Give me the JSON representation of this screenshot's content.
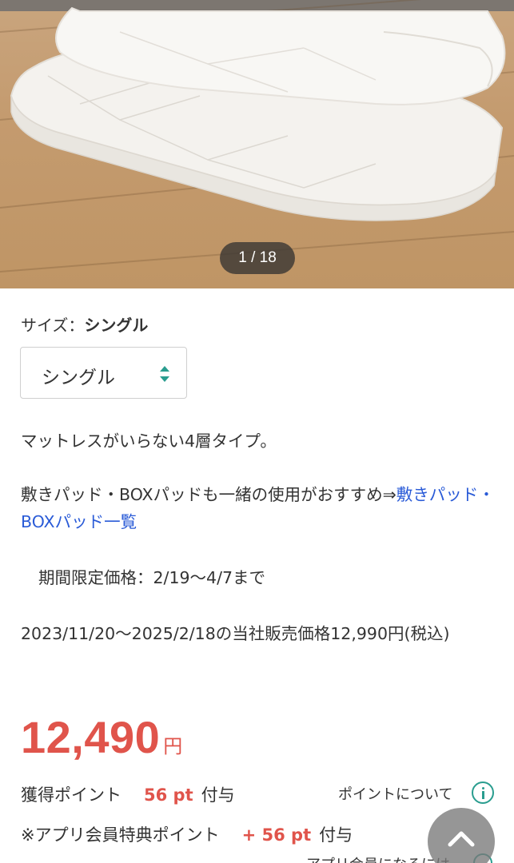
{
  "gallery": {
    "counter": "1 / 18",
    "image_alt": "folded white quilted mattress on wooden floor"
  },
  "size": {
    "label": "サイズ：",
    "value": "シングル",
    "select_value": "シングル"
  },
  "description": {
    "line1": "マットレスがいらない4層タイプ。",
    "line2_text": "敷きパッド・BOXパッドも一緒の使用がおすすめ⇒",
    "line2_link": "敷きパッド・BOXパッド一覧",
    "period": "期間限定価格：2/19〜4/7まで",
    "reference_price": "2023/11/20〜2025/2/18の当社販売価格12,990円(税込)"
  },
  "price": {
    "amount": "12,490",
    "unit": "円"
  },
  "points": {
    "earned_label": "獲得ポイント",
    "earned_value": "56 pt",
    "earned_suffix": "付与",
    "about_link": "ポイントについて",
    "app_label": "※アプリ会員特典ポイント",
    "app_value": "+ 56 pt",
    "app_suffix": "付与",
    "app_member_text": "アプリ会員になるには"
  },
  "colors": {
    "price": "#e0544b",
    "link": "#2a5bd7",
    "accent": "#2a9d8f"
  }
}
